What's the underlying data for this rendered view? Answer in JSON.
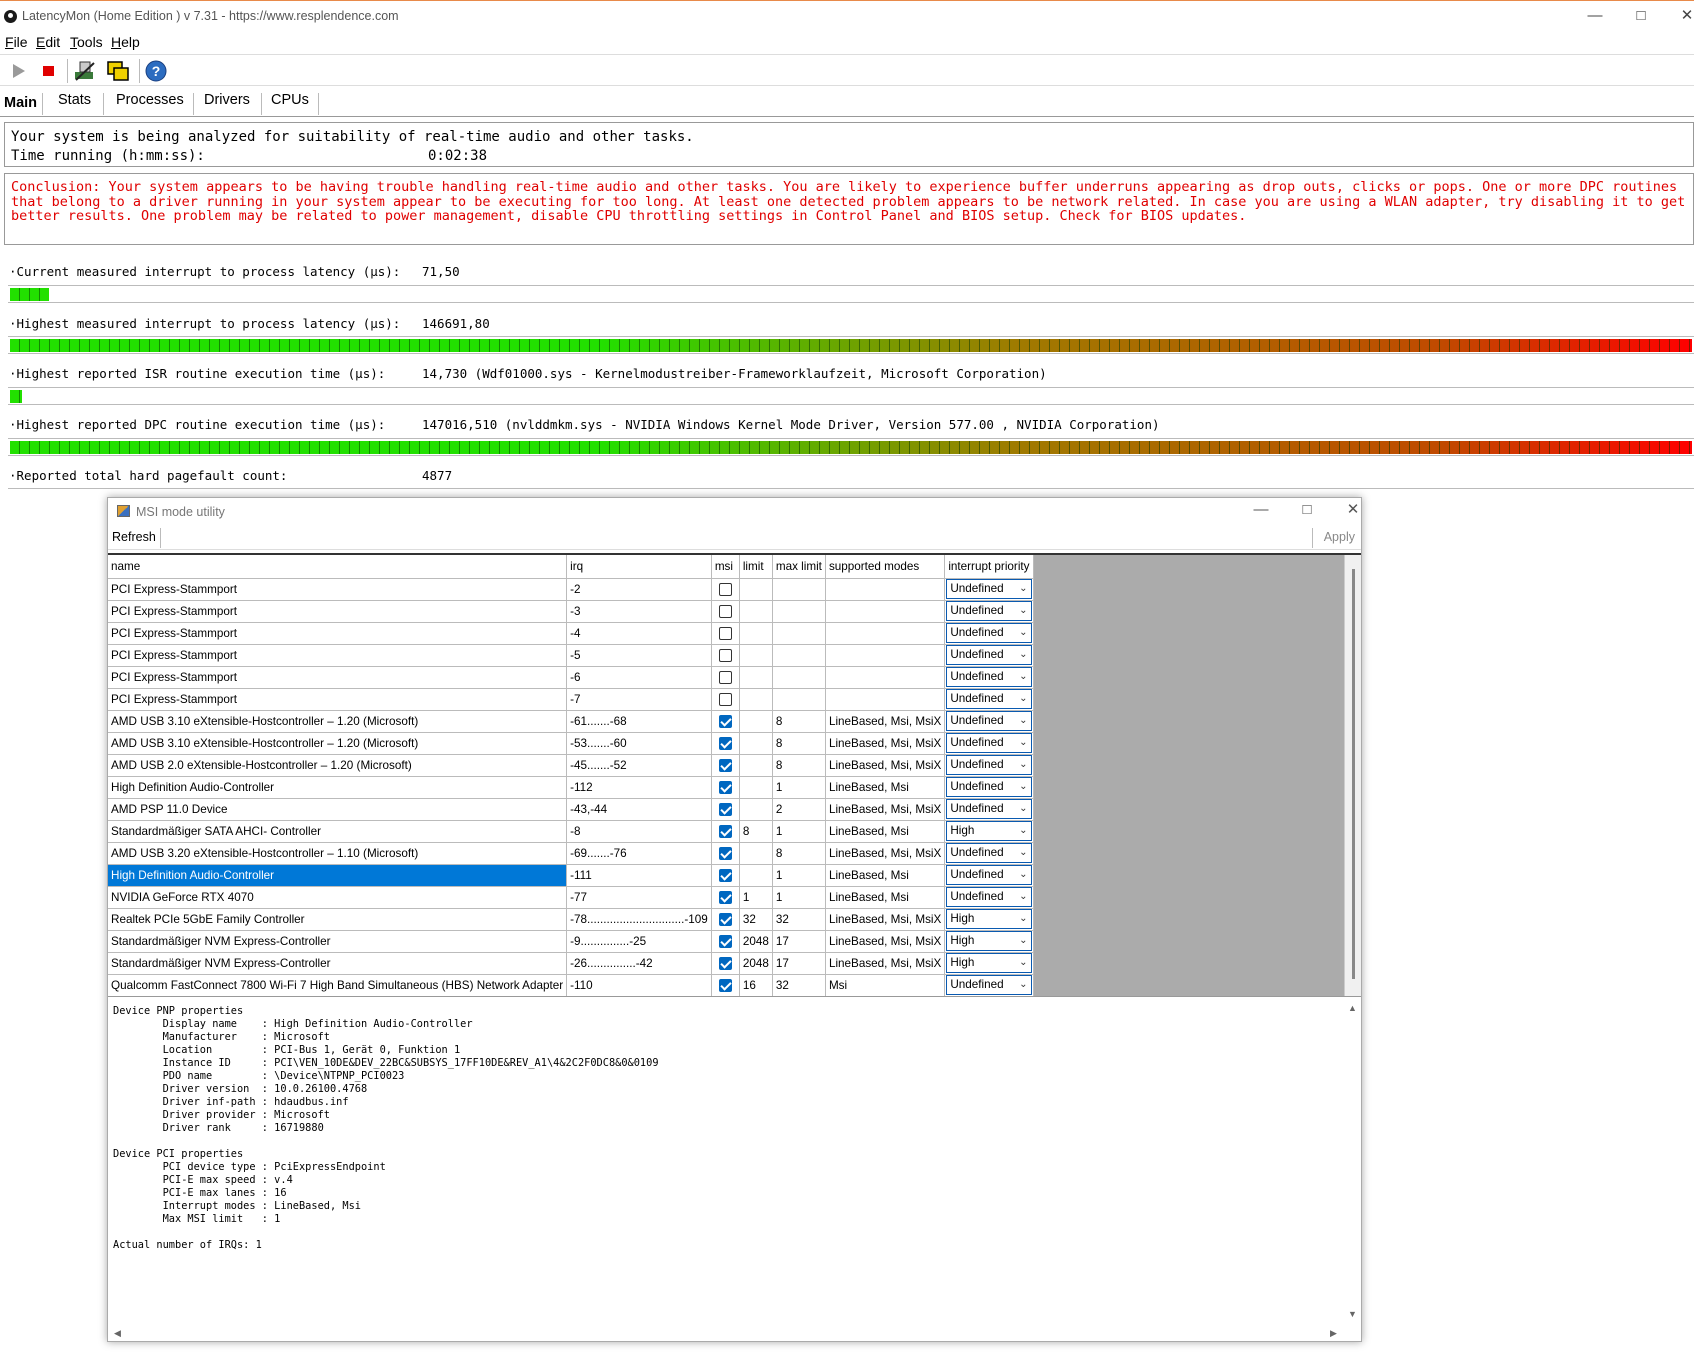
{
  "window": {
    "title": "LatencyMon  (Home Edition )  v 7.31 - https://www.resplendence.com"
  },
  "menu": [
    {
      "label": "File",
      "key": "F",
      "rest": "ile"
    },
    {
      "label": "Edit",
      "key": "E",
      "rest": "dit"
    },
    {
      "label": "Tools",
      "key": "T",
      "rest": "ools"
    },
    {
      "label": "Help",
      "key": "H",
      "rest": "elp"
    }
  ],
  "toolbar": {
    "icons": [
      "play-icon",
      "stop-icon",
      "hardware-icon",
      "windows-icon",
      "help-icon"
    ]
  },
  "tabs": [
    "Main",
    "Stats",
    "Processes",
    "Drivers",
    "CPUs"
  ],
  "status": {
    "line1": "Your system is being analyzed for suitability of real-time audio and other tasks.",
    "time_label": "Time running (h:mm:ss):",
    "time_value": "0:02:38"
  },
  "conclusion": "Conclusion: Your system appears to be having trouble handling real-time audio and other tasks. You are likely to experience buffer underruns appearing as drop outs, clicks or pops. One or more DPC routines that belong to a driver running in your system appear to be executing for too long. At least one detected problem appears to be network related. In case you are using a WLAN adapter, try disabling it to get better results. One problem may be related to power management, disable CPU throttling settings in Control Panel and BIOS setup. Check for BIOS updates.",
  "metrics": [
    {
      "label": "·Current measured interrupt to process latency (µs):",
      "value": "71,50",
      "level": 0.023
    },
    {
      "label": "·Highest measured interrupt to process latency (µs):",
      "value": "146691,80",
      "level": 1.0
    },
    {
      "label": "·Highest reported ISR routine execution time (µs):",
      "value": "14,730   (Wdf01000.sys - Kernelmodustreiber-Frameworklaufzeit, Microsoft Corporation)",
      "level": 0.007
    },
    {
      "label": "·Highest reported DPC routine execution time (µs):",
      "value": "147016,510   (nvlddmkm.sys - NVIDIA Windows Kernel Mode Driver, Version 577.00 , NVIDIA Corporation)",
      "level": 1.0
    },
    {
      "label": "·Reported total hard pagefault count:",
      "value": "4877"
    }
  ],
  "msi": {
    "title": "MSI mode utility",
    "refresh": "Refresh",
    "apply": "Apply",
    "columns": [
      "name",
      "irq",
      "msi",
      "limit",
      "max limit",
      "supported modes",
      "interrupt priority"
    ],
    "rows": [
      {
        "name": "PCI Express-Stammport",
        "irq": "-2",
        "msi": false,
        "limit": "",
        "max": "",
        "modes": "",
        "prio": "Undefined"
      },
      {
        "name": "PCI Express-Stammport",
        "irq": "-3",
        "msi": false,
        "limit": "",
        "max": "",
        "modes": "",
        "prio": "Undefined"
      },
      {
        "name": "PCI Express-Stammport",
        "irq": "-4",
        "msi": false,
        "limit": "",
        "max": "",
        "modes": "",
        "prio": "Undefined"
      },
      {
        "name": "PCI Express-Stammport",
        "irq": "-5",
        "msi": false,
        "limit": "",
        "max": "",
        "modes": "",
        "prio": "Undefined"
      },
      {
        "name": "PCI Express-Stammport",
        "irq": "-6",
        "msi": false,
        "limit": "",
        "max": "",
        "modes": "",
        "prio": "Undefined"
      },
      {
        "name": "PCI Express-Stammport",
        "irq": "-7",
        "msi": false,
        "limit": "",
        "max": "",
        "modes": "",
        "prio": "Undefined"
      },
      {
        "name": "AMD USB 3.10 eXtensible-Hostcontroller – 1.20 (Microsoft)",
        "irq": "-61.......-68",
        "msi": true,
        "limit": "",
        "max": "8",
        "modes": "LineBased, Msi, MsiX",
        "prio": "Undefined"
      },
      {
        "name": "AMD USB 3.10 eXtensible-Hostcontroller – 1.20 (Microsoft)",
        "irq": "-53.......-60",
        "msi": true,
        "limit": "",
        "max": "8",
        "modes": "LineBased, Msi, MsiX",
        "prio": "Undefined"
      },
      {
        "name": "AMD USB 2.0 eXtensible-Hostcontroller – 1.20 (Microsoft)",
        "irq": "-45.......-52",
        "msi": true,
        "limit": "",
        "max": "8",
        "modes": "LineBased, Msi, MsiX",
        "prio": "Undefined"
      },
      {
        "name": "High Definition Audio-Controller",
        "irq": "-112",
        "msi": true,
        "limit": "",
        "max": "1",
        "modes": "LineBased, Msi",
        "prio": "Undefined"
      },
      {
        "name": "AMD PSP 11.0 Device",
        "irq": "-43,-44",
        "msi": true,
        "limit": "",
        "max": "2",
        "modes": "LineBased, Msi, MsiX",
        "prio": "Undefined"
      },
      {
        "name": "Standardmäßiger SATA AHCI- Controller",
        "irq": "-8",
        "msi": true,
        "limit": "8",
        "max": "1",
        "modes": "LineBased, Msi",
        "prio": "High"
      },
      {
        "name": "AMD USB 3.20 eXtensible-Hostcontroller – 1.10 (Microsoft)",
        "irq": "-69.......-76",
        "msi": true,
        "limit": "",
        "max": "8",
        "modes": "LineBased, Msi, MsiX",
        "prio": "Undefined"
      },
      {
        "name": "High Definition Audio-Controller",
        "irq": "-111",
        "msi": true,
        "limit": "",
        "max": "1",
        "modes": "LineBased, Msi",
        "prio": "Undefined",
        "selected": true
      },
      {
        "name": "NVIDIA GeForce RTX 4070",
        "irq": "-77",
        "msi": true,
        "limit": "1",
        "max": "1",
        "modes": "LineBased, Msi",
        "prio": "Undefined"
      },
      {
        "name": "Realtek PCIe 5GbE Family Controller",
        "irq": "-78..............................-109",
        "msi": true,
        "limit": "32",
        "max": "32",
        "modes": "LineBased, Msi, MsiX",
        "prio": "High"
      },
      {
        "name": "Standardmäßiger NVM Express-Controller",
        "irq": "-9...............-25",
        "msi": true,
        "limit": "2048",
        "max": "17",
        "modes": "LineBased, Msi, MsiX",
        "prio": "High"
      },
      {
        "name": "Standardmäßiger NVM Express-Controller",
        "irq": "-26...............-42",
        "msi": true,
        "limit": "2048",
        "max": "17",
        "modes": "LineBased, Msi, MsiX",
        "prio": "High"
      },
      {
        "name": "Qualcomm FastConnect 7800 Wi-Fi 7 High Band Simultaneous (HBS) Network Adapter",
        "irq": "-110",
        "msi": true,
        "limit": "16",
        "max": "32",
        "modes": "Msi",
        "prio": "Undefined"
      }
    ],
    "properties": "Device PNP properties\n        Display name    : High Definition Audio-Controller\n        Manufacturer    : Microsoft\n        Location        : PCI-Bus 1, Gerät 0, Funktion 1\n        Instance ID     : PCI\\VEN_10DE&DEV_22BC&SUBSYS_17FF10DE&REV_A1\\4&2C2F0DC8&0&0109\n        PDO name        : \\Device\\NTPNP_PCI0023\n        Driver version  : 10.0.26100.4768\n        Driver inf-path : hdaudbus.inf\n        Driver provider : Microsoft\n        Driver rank     : 16719880\n\nDevice PCI properties\n        PCI device type : PciExpressEndpoint\n        PCI-E max speed : v.4\n        PCI-E max lanes : 16\n        Interrupt modes : LineBased, Msi\n        Max MSI limit   : 1\n\nActual number of IRQs: 1"
  }
}
